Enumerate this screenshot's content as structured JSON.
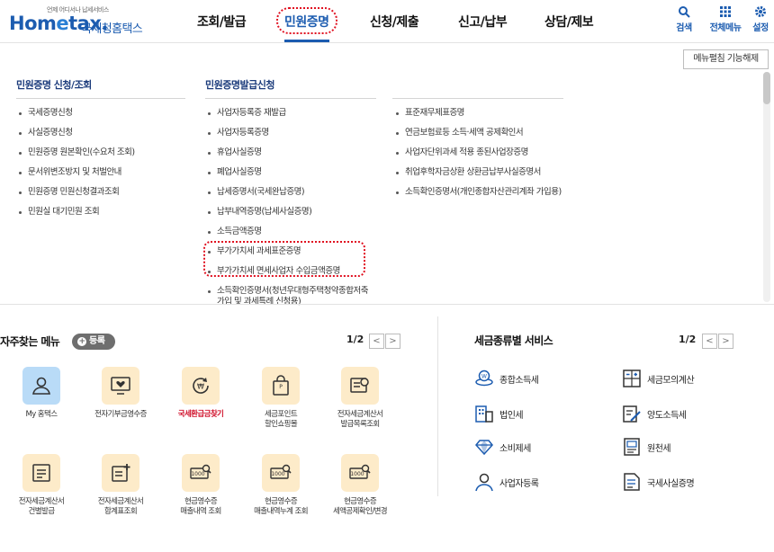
{
  "header": {
    "logo_tag": "언제 어디서나 납세서비스",
    "logo_text_a": "Hom",
    "logo_text_e": "e",
    "logo_text_b": "tax.",
    "logo_name": "국세청홈택스",
    "gnb": [
      "조회/발급",
      "민원증명",
      "신청/제출",
      "신고/납부",
      "상담/제보"
    ],
    "active_gnb": "민원증명",
    "util": {
      "search": "검색",
      "all_menu": "전체메뉴",
      "settings": "설정"
    },
    "accent": "#1c5cb0"
  },
  "panel": {
    "unfold_button": "메뉴펼침 기능해제",
    "col1": {
      "title": "민원증명 신청/조회",
      "items": [
        "국세증명신청",
        "사실증명신청",
        "민원증명 원본확인(수요처 조회)",
        "문서위변조방지 및 처벌안내",
        "민원증명 민원신청결과조회",
        "민원실 대기민원 조회"
      ]
    },
    "col2": {
      "title": "민원증명발급신청",
      "items": [
        "사업자등록증 재발급",
        "사업자등록증명",
        "휴업사실증명",
        "폐업사실증명",
        "납세증명서(국세완납증명)",
        "납부내역증명(납세사실증명)",
        "소득금액증명",
        "부가가치세 과세표준증명",
        "부가가치세 면세사업자 수입금액증명",
        "소득확인증명서(청년우대형주택청약종합저축 가입 및 과세특례 신청용)"
      ]
    },
    "col3": {
      "items": [
        "표준재무제표증명",
        "연금보험료등 소득·세액 공제확인서",
        "사업자단위과세 적용 종된사업장증명",
        "취업후학자금상환 상환금납부사실증명서",
        "소득확인증명서(개인종합자산관리계좌 가입용)"
      ]
    }
  },
  "favorites": {
    "title": "자주찾는 메뉴",
    "register": "등록",
    "page": "1/2",
    "prev": "<",
    "next": ">",
    "items": [
      {
        "label1": "My 홈택스",
        "label2": ""
      },
      {
        "label1": "전자기부금영수증",
        "label2": ""
      },
      {
        "label1": "국세환급금찾기",
        "label2": ""
      },
      {
        "label1": "세금포인트",
        "label2": "할인쇼핑몰"
      },
      {
        "label1": "전자세금계산서",
        "label2": "발급목록조회"
      },
      {
        "label1": "전자세금계산서",
        "label2": "건별발급"
      },
      {
        "label1": "전자세금계산서",
        "label2": "합계표조회"
      },
      {
        "label1": "현금영수증",
        "label2": "매출내역 조회"
      },
      {
        "label1": "현금영수증",
        "label2": "매출내역누계 조회"
      },
      {
        "label1": "현금영수증",
        "label2": "세액공제확인/변경"
      }
    ],
    "coin_text": "1000"
  },
  "tax_services": {
    "title": "세금종류별 서비스",
    "page": "1/2",
    "prev": "<",
    "next": ">",
    "items": [
      "종합소득세",
      "세금모의계산",
      "법인세",
      "양도소득세",
      "소비제세",
      "원천세",
      "사업자등록",
      "국세사실증명"
    ]
  }
}
